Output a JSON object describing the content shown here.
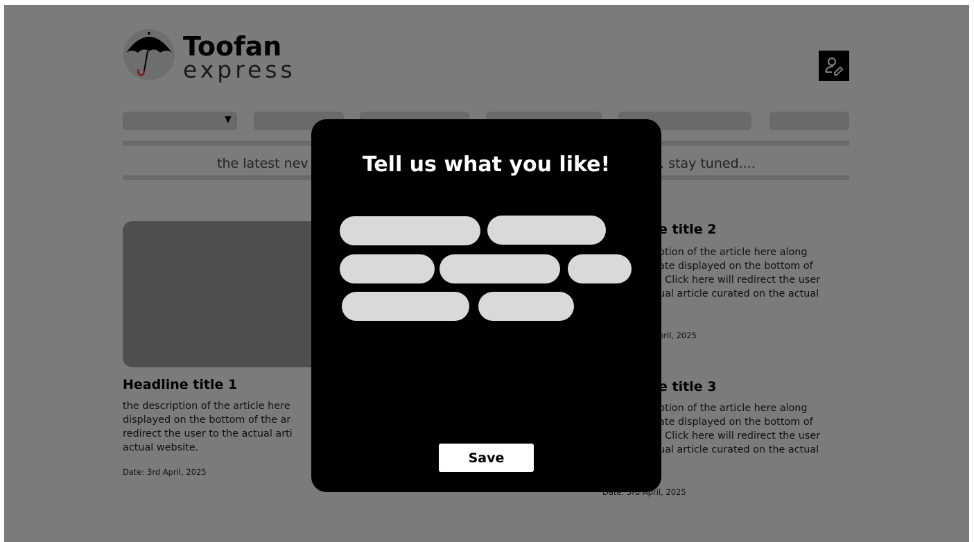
{
  "brand": {
    "name": "Toofan",
    "sub": "express"
  },
  "icons": {
    "logo": "umbrella-icon",
    "profile": "user-edit-icon",
    "nav_dropdown": "triangle-down-icon"
  },
  "nav": {
    "dropdown_arrow": "▼"
  },
  "ticker": {
    "left_text": "the latest nev",
    "right_text": ". stay tuned...."
  },
  "articles": [
    {
      "headline": "Headline title 1",
      "description": [
        "the description of the article here",
        "displayed on the bottom of the ar",
        "redirect the user to the actual arti",
        "actual website."
      ],
      "date": "Date: 3rd April, 2025"
    },
    {
      "headline": "e title 2",
      "description": [
        "ption of the article here along",
        "ate displayed on the bottom of",
        ". Click here will redirect the user",
        "ual article curated on the actual"
      ],
      "date": "pril, 2025"
    },
    {
      "headline": "e title 3",
      "description": [
        "ption of the article here along",
        "ate displayed on the bottom of",
        ". Click here will redirect the user",
        "ual article curated on the actual"
      ],
      "date": "Date: 3rd April, 2025"
    }
  ],
  "modal": {
    "title": "Tell us what you like!",
    "save_label": "Save"
  },
  "colors": {
    "overlay": "#7b7b7b",
    "modal_bg": "#000000",
    "chip": "#d9d9d9",
    "accent_red": "#b01c24"
  }
}
